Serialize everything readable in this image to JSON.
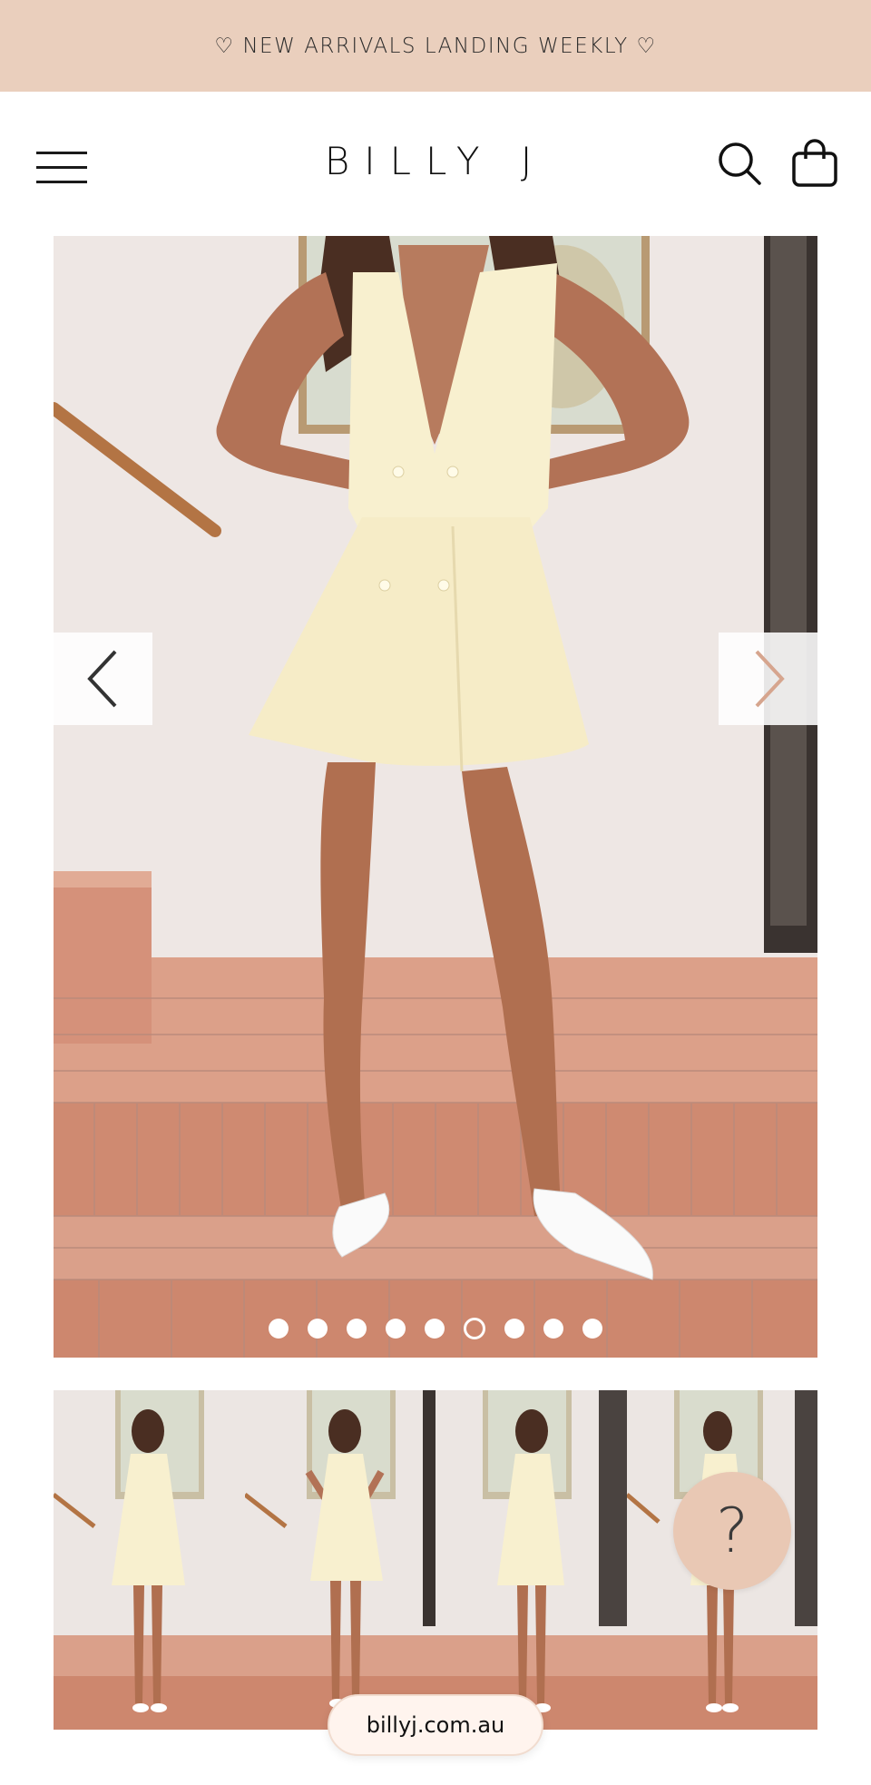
{
  "announcement": {
    "text": "♡ NEW ARRIVALS LANDING WEEKLY ♡"
  },
  "header": {
    "logo": "BILLY J",
    "menu_icon": "hamburger-menu-icon",
    "search_icon": "search-icon",
    "cart_icon": "shopping-bag-icon"
  },
  "gallery": {
    "prev_icon": "chevron-left-icon",
    "next_icon": "chevron-right-icon",
    "dot_count": 9,
    "active_dot": 6
  },
  "help": {
    "label": "?"
  },
  "browser": {
    "url": "billyj.com.au"
  },
  "colors": {
    "announcement_bg": "#eacfbd",
    "help_bg": "#e9c8b4",
    "dress": "#f8f0cf",
    "tiles": "#d79a82"
  }
}
